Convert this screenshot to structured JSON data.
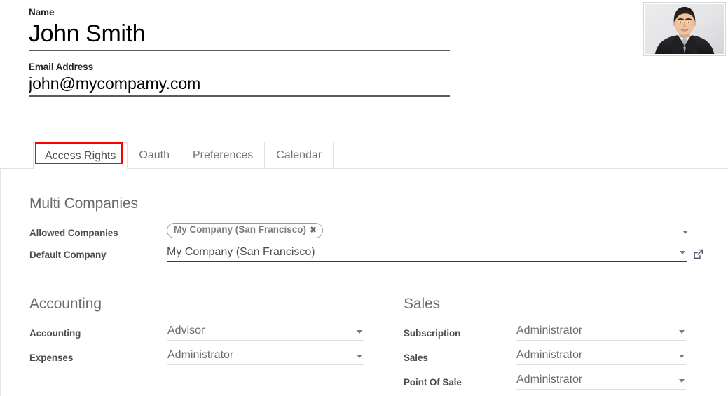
{
  "record": {
    "name_label": "Name",
    "name_value": "John Smith",
    "email_label": "Email Address",
    "email_value": "john@mycompamy.com",
    "avatar_alt": "user-photo"
  },
  "tabs": [
    {
      "label": "Access Rights",
      "active": true,
      "highlighted": true
    },
    {
      "label": "Oauth",
      "active": false,
      "highlighted": false
    },
    {
      "label": "Preferences",
      "active": false,
      "highlighted": false
    },
    {
      "label": "Calendar",
      "active": false,
      "highlighted": false
    }
  ],
  "multi_companies": {
    "title": "Multi Companies",
    "allowed_companies": {
      "label": "Allowed Companies",
      "tags": [
        "My Company (San Francisco)"
      ],
      "remove_glyph": "✖"
    },
    "default_company": {
      "label": "Default Company",
      "value": "My Company (San Francisco)",
      "has_external_link": true
    }
  },
  "accounting": {
    "title": "Accounting",
    "fields": [
      {
        "label": "Accounting",
        "value": "Advisor"
      },
      {
        "label": "Expenses",
        "value": "Administrator"
      }
    ]
  },
  "sales": {
    "title": "Sales",
    "fields": [
      {
        "label": "Subscription",
        "value": "Administrator"
      },
      {
        "label": "Sales",
        "value": "Administrator"
      },
      {
        "label": "Point Of Sale",
        "value": "Administrator"
      }
    ]
  },
  "colors": {
    "highlight": "#ff0000",
    "tab_border": "#dee2e6",
    "label_text": "#4d4d4d",
    "value_text": "#6b6b6b",
    "underline_active": "#3c3c3c",
    "underline_idle": "#e0e0e0"
  }
}
